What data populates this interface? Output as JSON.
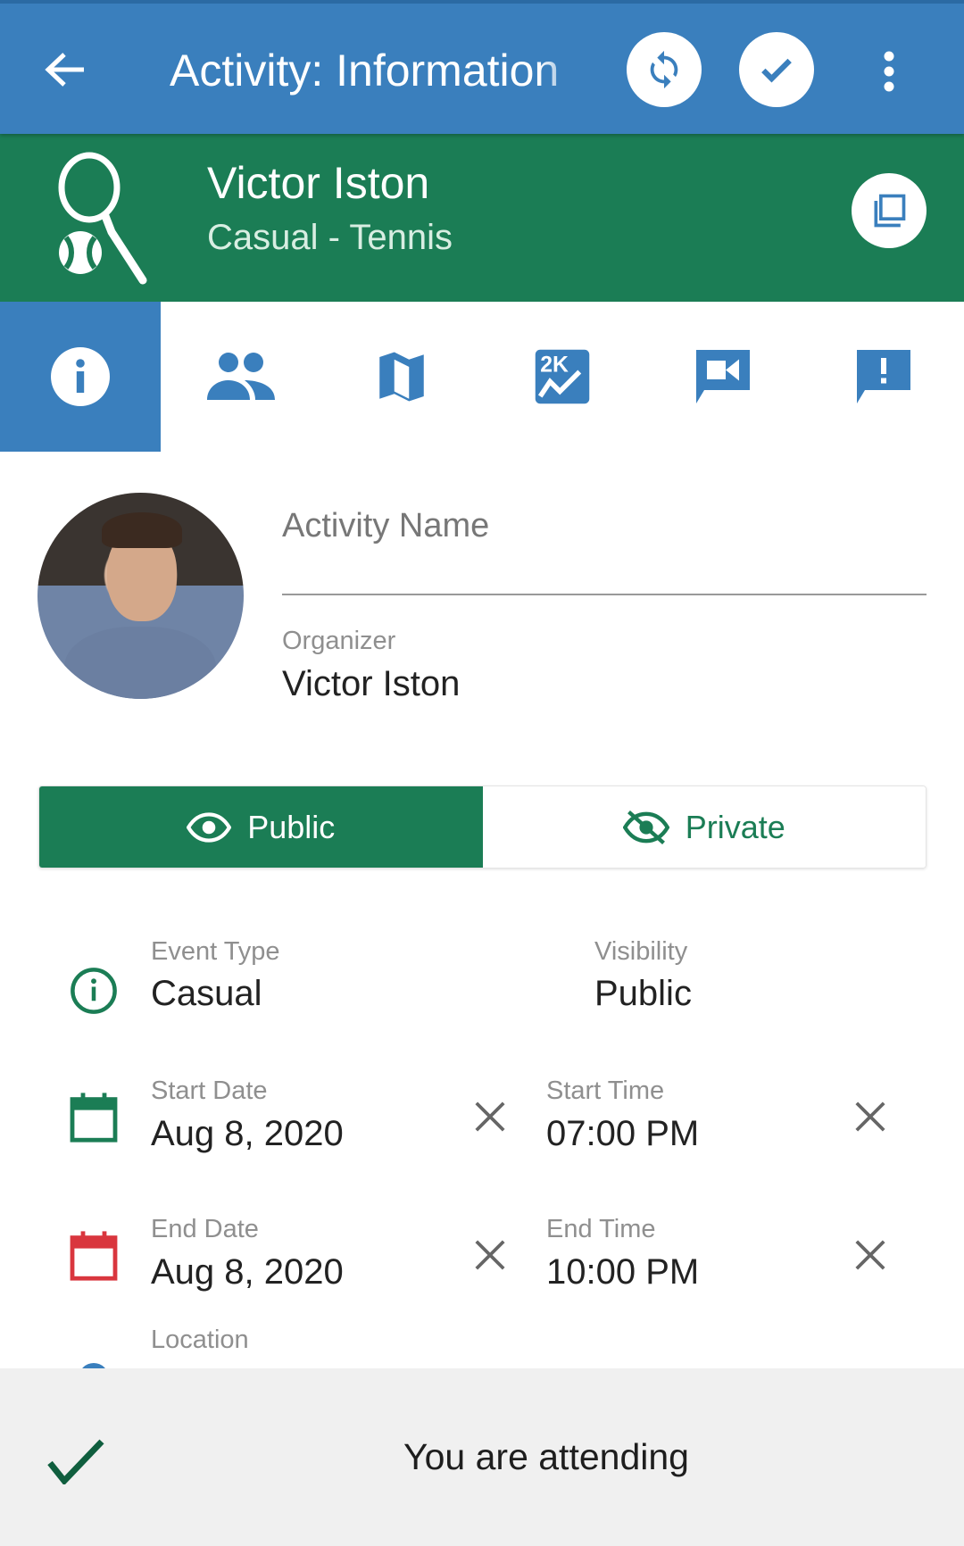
{
  "colors": {
    "primary": "#3a7fbd",
    "green": "#1b7d55",
    "red": "#d9363e"
  },
  "appbar": {
    "title": "Activity: Information",
    "back_icon": "arrow-left-icon",
    "refresh_icon": "sync-icon",
    "confirm_icon": "check-icon",
    "menu_icon": "more-vert-icon"
  },
  "header": {
    "name": "Victor Iston",
    "subtitle": "Casual - Tennis",
    "sport_icon": "tennis-icon",
    "copy_icon": "copy-icon"
  },
  "tabs": [
    {
      "icon": "info-icon",
      "active": true
    },
    {
      "icon": "people-icon"
    },
    {
      "icon": "map-icon"
    },
    {
      "icon": "chart-icon"
    },
    {
      "icon": "video-chat-icon"
    },
    {
      "icon": "report-icon"
    }
  ],
  "form": {
    "activity_name_placeholder": "Activity Name",
    "organizer_label": "Organizer",
    "organizer_value": "Victor Iston"
  },
  "visibility_toggle": {
    "public": "Public",
    "private": "Private",
    "selected": "Public"
  },
  "details": {
    "event_type_label": "Event Type",
    "event_type_value": "Casual",
    "visibility_label": "Visibility",
    "visibility_value": "Public",
    "start_date_label": "Start Date",
    "start_date_value": "Aug 8, 2020",
    "start_time_label": "Start Time",
    "start_time_value": "07:00 PM",
    "end_date_label": "End Date",
    "end_date_value": "Aug 8, 2020",
    "end_time_label": "End Time",
    "end_time_value": "10:00 PM",
    "location_label": "Location"
  },
  "snackbar": {
    "message": "You are attending"
  }
}
